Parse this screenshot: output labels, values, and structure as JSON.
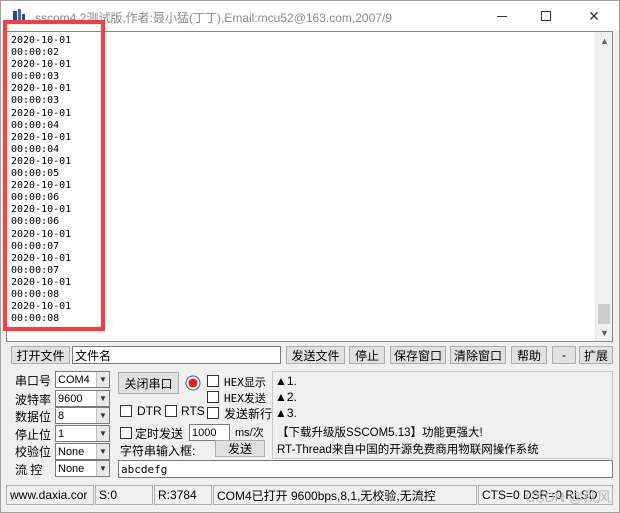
{
  "title_bar": {
    "title": "sscom4.2测试版,作者:聂小猛(丁丁),Email:mcu52@163.com,2007/9"
  },
  "receive_area": {
    "text": "2020-10-01\n00:00:02\n2020-10-01\n00:00:03\n2020-10-01\n00:00:03\n2020-10-01\n00:00:04\n2020-10-01\n00:00:04\n2020-10-01\n00:00:05\n2020-10-01\n00:00:06\n2020-10-01\n00:00:06\n2020-10-01\n00:00:07\n2020-10-01\n00:00:07\n2020-10-01\n00:00:08\n2020-10-01\n00:00:08"
  },
  "toolbar": {
    "open_file": "打开文件",
    "file_name": "文件名",
    "send_file": "发送文件",
    "stop": "停止",
    "save_window": "保存窗口",
    "clear_window": "清除窗口",
    "help": "帮助",
    "minus": "-",
    "expand": "扩展"
  },
  "settings": {
    "port_label": "串口号",
    "port_value": "COM4",
    "baud_label": "波特率",
    "baud_value": "9600",
    "databits_label": "数据位",
    "databits_value": "8",
    "stopbits_label": "停止位",
    "stopbits_value": "1",
    "parity_label": "校验位",
    "parity_value": "None",
    "flow_label": "流 控",
    "flow_value": "None",
    "close_port_button": "关闭串口",
    "hex_display": "HEX显示",
    "hex_send": "HEX发送",
    "dtr": "DTR",
    "rts": "RTS",
    "send_newline": "发送新行",
    "timed_send": "定时发送",
    "interval_value": "1000",
    "interval_unit": "ms/次",
    "char_input_label": "字符串输入框:",
    "send_button": "发送",
    "send_input_value": "abcdefg"
  },
  "info_panel": {
    "line1": "▲1.",
    "line2": "▲2.",
    "line3": "▲3.",
    "promo1": "【下载升级版SSCOM5.13】功能更强大!",
    "promo2": "RT-Thread来自中国的开源免费商用物联网操作系统"
  },
  "status_bar": {
    "website": "www.daxia.cor",
    "sent": "S:0",
    "received": "R:3784",
    "port_status": "COM4已打开  9600bps,8,1,无校验,无流控",
    "signals": "CTS=0 DSR=0 RLSD"
  },
  "overlay": {
    "watermark": "CSDN @秋风"
  },
  "colors": {
    "highlight": "#ff3b3b",
    "window_bg": "#f0f0f0"
  }
}
